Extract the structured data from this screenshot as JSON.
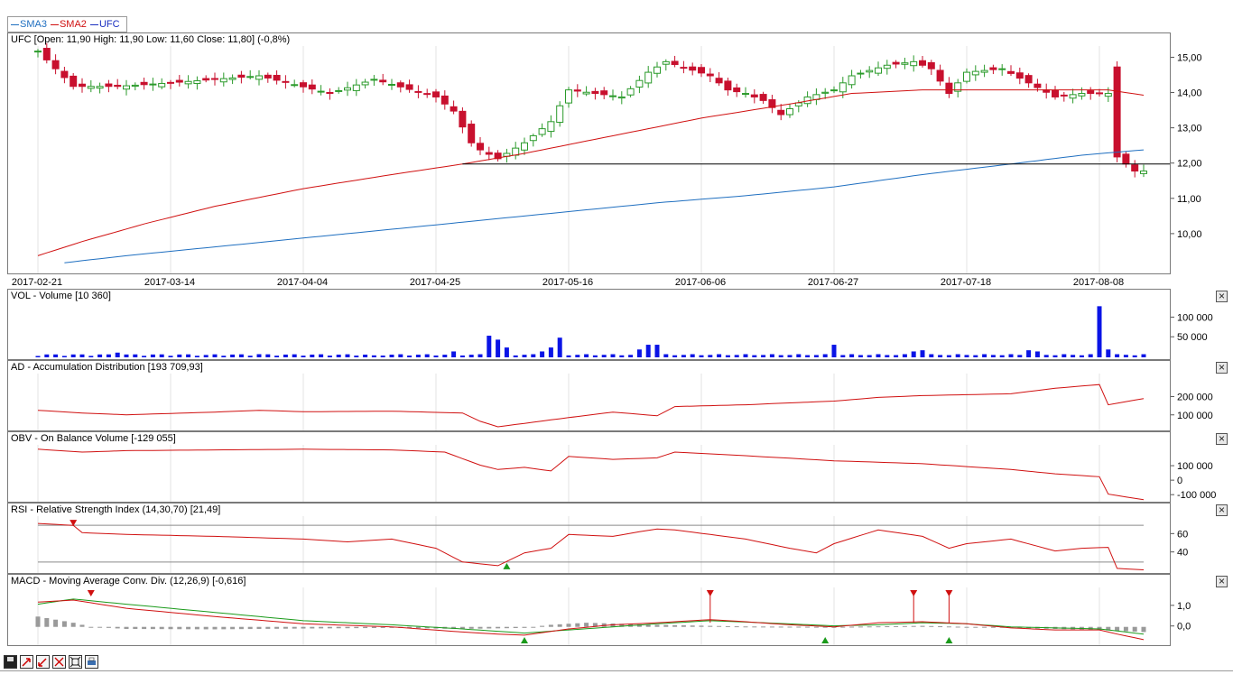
{
  "legend": [
    {
      "label": "SMA3",
      "color": "#1f6fc0"
    },
    {
      "label": "SMA2",
      "color": "#d01010"
    },
    {
      "label": "UFC",
      "color": "#1a2fc0"
    }
  ],
  "colors": {
    "bull": "#2a9a2a",
    "bear": "#c8102e",
    "volume": "#0a14e6",
    "indicator": "#d01010",
    "signal": "#1a9a1a",
    "sma3": "#1f6fc0",
    "hist": "#9a9a9a"
  },
  "panels": {
    "price": {
      "title": "UFC [Open: 11,90  High: 11,90  Low: 11,60  Close: 11,80] (-0,8%)"
    },
    "vol": {
      "title": "VOL - Volume [10 360]",
      "ticks": [
        "100 000",
        "50 000"
      ]
    },
    "ad": {
      "title": "AD - Accumulation Distribution [193 709,93]",
      "ticks": [
        "200 000",
        "100 000"
      ]
    },
    "obv": {
      "title": "OBV - On Balance Volume [-129 055]",
      "ticks": [
        "100 000",
        "0",
        "-100 000"
      ]
    },
    "rsi": {
      "title": "RSI - Relative Strength Index (14,30,70) [21,49]",
      "ticks": [
        "60",
        "40"
      ]
    },
    "macd": {
      "title": "MACD - Moving Average Conv. Div. (12,26,9) [-0,616]",
      "ticks": [
        "1,0",
        "0,0"
      ]
    }
  },
  "toolbar": {
    "icons": [
      "save-icon",
      "zoom-in-icon",
      "zoom-out-icon",
      "zoom-reset-icon",
      "fit-icon",
      "print-icon"
    ]
  },
  "chart_data": [
    {
      "type": "candlestick",
      "title": "UFC [Open: 11,90  High: 11,90  Low: 11,60  Close: 11,80] (-0,8%)",
      "x_ticks": [
        "2017-02-21",
        "2017-03-14",
        "2017-04-04",
        "2017-04-25",
        "2017-05-16",
        "2017-06-06",
        "2017-06-27",
        "2017-07-18",
        "2017-08-08"
      ],
      "y_ticks": [
        "15,00",
        "14,00",
        "13,00",
        "12,00",
        "11,00",
        "10,00"
      ],
      "ylim": [
        9.0,
        15.6
      ],
      "horizontal_line": 12.0,
      "keypoints": {
        "close": [
          [
            0,
            15.2
          ],
          [
            4,
            14.2
          ],
          [
            9,
            14.2
          ],
          [
            15,
            14.3
          ],
          [
            25,
            14.5
          ],
          [
            33,
            14.0
          ],
          [
            38,
            14.4
          ],
          [
            45,
            13.9
          ],
          [
            47,
            13.5
          ],
          [
            49,
            12.6
          ],
          [
            50,
            12.4
          ],
          [
            52,
            12.15
          ],
          [
            55,
            12.6
          ],
          [
            58,
            13.2
          ],
          [
            60,
            14.1
          ],
          [
            63,
            14.0
          ],
          [
            66,
            13.9
          ],
          [
            69,
            14.6
          ],
          [
            71,
            14.9
          ],
          [
            76,
            14.5
          ],
          [
            78,
            14.1
          ],
          [
            80,
            14.0
          ],
          [
            82,
            13.8
          ],
          [
            84,
            13.4
          ],
          [
            87,
            13.9
          ],
          [
            90,
            14.1
          ],
          [
            92,
            14.5
          ],
          [
            96,
            14.8
          ],
          [
            99,
            14.9
          ],
          [
            101,
            14.7
          ],
          [
            103,
            14.0
          ],
          [
            105,
            14.6
          ],
          [
            109,
            14.7
          ],
          [
            112,
            14.3
          ],
          [
            115,
            13.9
          ],
          [
            118,
            14.0
          ],
          [
            121,
            14.0
          ],
          [
            122,
            12.2
          ],
          [
            124,
            11.8
          ],
          [
            125,
            11.8
          ]
        ],
        "sma2": [
          [
            0,
            9.4
          ],
          [
            5,
            9.8
          ],
          [
            12,
            10.3
          ],
          [
            20,
            10.8
          ],
          [
            30,
            11.3
          ],
          [
            40,
            11.7
          ],
          [
            48,
            12.0
          ],
          [
            55,
            12.3
          ],
          [
            65,
            12.8
          ],
          [
            75,
            13.3
          ],
          [
            85,
            13.7
          ],
          [
            92,
            14.0
          ],
          [
            100,
            14.1
          ],
          [
            110,
            14.1
          ],
          [
            118,
            14.1
          ],
          [
            121,
            14.1
          ],
          [
            125,
            13.95
          ]
        ],
        "sma3": [
          [
            3,
            9.2
          ],
          [
            10,
            9.4
          ],
          [
            20,
            9.65
          ],
          [
            30,
            9.9
          ],
          [
            40,
            10.15
          ],
          [
            50,
            10.4
          ],
          [
            60,
            10.65
          ],
          [
            70,
            10.9
          ],
          [
            80,
            11.1
          ],
          [
            90,
            11.35
          ],
          [
            100,
            11.7
          ],
          [
            110,
            12.0
          ],
          [
            118,
            12.25
          ],
          [
            125,
            12.4
          ]
        ]
      }
    },
    {
      "type": "bar",
      "title": "VOL - Volume [10 360]",
      "y_ticks": [
        "100 000",
        "50 000"
      ],
      "ylim": [
        0,
        140000
      ],
      "spikes": [
        [
          9,
          12000
        ],
        [
          19,
          6000
        ],
        [
          25,
          8000
        ],
        [
          38,
          5000
        ],
        [
          47,
          15000
        ],
        [
          51,
          55000
        ],
        [
          52,
          45000
        ],
        [
          53,
          25000
        ],
        [
          57,
          15000
        ],
        [
          58,
          25000
        ],
        [
          59,
          50000
        ],
        [
          68,
          20000
        ],
        [
          69,
          32000
        ],
        [
          70,
          32000
        ],
        [
          90,
          32000
        ],
        [
          99,
          15000
        ],
        [
          100,
          18000
        ],
        [
          112,
          18000
        ],
        [
          113,
          15000
        ],
        [
          120,
          130000
        ],
        [
          121,
          20000
        ]
      ]
    },
    {
      "type": "line",
      "title": "AD - Accumulation Distribution [193 709,93]",
      "y_ticks": [
        "200 000",
        "100 000"
      ],
      "ylim": [
        30000,
        330000
      ],
      "keypoints": [
        [
          0,
          130000
        ],
        [
          5,
          115000
        ],
        [
          10,
          105000
        ],
        [
          20,
          120000
        ],
        [
          25,
          130000
        ],
        [
          30,
          122000
        ],
        [
          40,
          125000
        ],
        [
          48,
          115000
        ],
        [
          50,
          70000
        ],
        [
          52,
          40000
        ],
        [
          56,
          65000
        ],
        [
          60,
          90000
        ],
        [
          65,
          120000
        ],
        [
          70,
          100000
        ],
        [
          72,
          150000
        ],
        [
          80,
          160000
        ],
        [
          90,
          180000
        ],
        [
          95,
          200000
        ],
        [
          100,
          210000
        ],
        [
          110,
          220000
        ],
        [
          115,
          250000
        ],
        [
          120,
          270000
        ],
        [
          121,
          160000
        ],
        [
          125,
          193700
        ]
      ]
    },
    {
      "type": "line",
      "title": "OBV - On Balance Volume [-129 055]",
      "y_ticks": [
        "100 000",
        "0",
        "-100 000"
      ],
      "ylim": [
        -130000,
        250000
      ],
      "keypoints": [
        [
          0,
          220000
        ],
        [
          5,
          200000
        ],
        [
          10,
          210000
        ],
        [
          20,
          215000
        ],
        [
          30,
          220000
        ],
        [
          40,
          215000
        ],
        [
          46,
          200000
        ],
        [
          50,
          110000
        ],
        [
          52,
          80000
        ],
        [
          55,
          95000
        ],
        [
          58,
          70000
        ],
        [
          60,
          170000
        ],
        [
          65,
          150000
        ],
        [
          70,
          160000
        ],
        [
          72,
          200000
        ],
        [
          80,
          175000
        ],
        [
          90,
          140000
        ],
        [
          100,
          120000
        ],
        [
          110,
          80000
        ],
        [
          115,
          50000
        ],
        [
          120,
          30000
        ],
        [
          121,
          -90000
        ],
        [
          125,
          -129055
        ]
      ]
    },
    {
      "type": "line",
      "title": "RSI - Relative Strength Index (14,30,70) [21,49]",
      "y_ticks": [
        "60",
        "40"
      ],
      "ylim": [
        20,
        80
      ],
      "guides": [
        70,
        30
      ],
      "keypoints": [
        [
          0,
          72
        ],
        [
          4,
          70
        ],
        [
          5,
          62
        ],
        [
          10,
          60
        ],
        [
          20,
          58
        ],
        [
          30,
          55
        ],
        [
          35,
          52
        ],
        [
          40,
          55
        ],
        [
          45,
          45
        ],
        [
          48,
          30
        ],
        [
          50,
          28
        ],
        [
          52,
          26
        ],
        [
          55,
          40
        ],
        [
          58,
          45
        ],
        [
          60,
          60
        ],
        [
          65,
          58
        ],
        [
          68,
          63
        ],
        [
          70,
          66
        ],
        [
          72,
          65
        ],
        [
          80,
          55
        ],
        [
          85,
          45
        ],
        [
          88,
          40
        ],
        [
          90,
          50
        ],
        [
          95,
          65
        ],
        [
          100,
          58
        ],
        [
          103,
          45
        ],
        [
          105,
          50
        ],
        [
          110,
          55
        ],
        [
          115,
          42
        ],
        [
          118,
          45
        ],
        [
          121,
          46
        ],
        [
          122,
          23
        ],
        [
          125,
          21.5
        ]
      ],
      "sell_markers": [
        4
      ],
      "buy_markers": [
        53
      ]
    },
    {
      "type": "line",
      "title": "MACD - Moving Average Conv. Div. (12,26,9) [-0,616]",
      "y_ticks": [
        "1,0",
        "0,0"
      ],
      "ylim": [
        -0.8,
        2.0
      ],
      "macd": [
        [
          0,
          1.2
        ],
        [
          4,
          1.3
        ],
        [
          10,
          0.9
        ],
        [
          20,
          0.5
        ],
        [
          30,
          0.15
        ],
        [
          40,
          0.0
        ],
        [
          48,
          -0.25
        ],
        [
          52,
          -0.35
        ],
        [
          55,
          -0.4
        ],
        [
          60,
          -0.1
        ],
        [
          65,
          0.1
        ],
        [
          70,
          0.2
        ],
        [
          76,
          0.35
        ],
        [
          80,
          0.25
        ],
        [
          85,
          0.1
        ],
        [
          90,
          0.0
        ],
        [
          95,
          0.2
        ],
        [
          100,
          0.25
        ],
        [
          105,
          0.15
        ],
        [
          110,
          -0.05
        ],
        [
          115,
          -0.15
        ],
        [
          120,
          -0.15
        ],
        [
          122,
          -0.35
        ],
        [
          125,
          -0.62
        ]
      ],
      "signal": [
        [
          0,
          1.1
        ],
        [
          4,
          1.35
        ],
        [
          10,
          1.1
        ],
        [
          20,
          0.7
        ],
        [
          30,
          0.3
        ],
        [
          40,
          0.1
        ],
        [
          48,
          -0.1
        ],
        [
          55,
          -0.3
        ],
        [
          60,
          -0.15
        ],
        [
          65,
          0.0
        ],
        [
          70,
          0.15
        ],
        [
          76,
          0.3
        ],
        [
          82,
          0.2
        ],
        [
          90,
          0.05
        ],
        [
          95,
          0.1
        ],
        [
          100,
          0.2
        ],
        [
          105,
          0.15
        ],
        [
          110,
          0.0
        ],
        [
          115,
          -0.05
        ],
        [
          120,
          -0.1
        ],
        [
          125,
          -0.35
        ]
      ],
      "hist": [
        [
          0,
          0.5
        ],
        [
          2,
          0.35
        ],
        [
          4,
          0.2
        ],
        [
          6,
          0.0
        ],
        [
          10,
          -0.1
        ],
        [
          20,
          -0.12
        ],
        [
          30,
          -0.08
        ],
        [
          40,
          -0.05
        ],
        [
          48,
          -0.1
        ],
        [
          55,
          -0.05
        ],
        [
          58,
          0.1
        ],
        [
          62,
          0.2
        ],
        [
          70,
          0.1
        ],
        [
          76,
          0.05
        ],
        [
          80,
          0.02
        ],
        [
          90,
          0.0
        ],
        [
          100,
          0.05
        ],
        [
          105,
          0.0
        ],
        [
          110,
          -0.05
        ],
        [
          115,
          -0.1
        ],
        [
          120,
          -0.15
        ],
        [
          125,
          -0.25
        ]
      ],
      "sell_markers": [
        6,
        76,
        99,
        103
      ],
      "buy_markers": [
        55,
        89,
        103
      ]
    }
  ]
}
